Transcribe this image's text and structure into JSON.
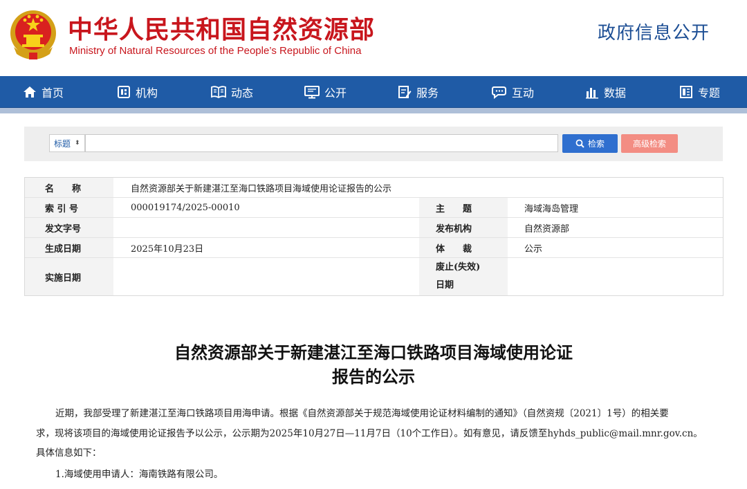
{
  "header": {
    "title_cn": "中华人民共和国自然资源部",
    "title_en": "Ministry of Natural Resources of the People’s Republic of China",
    "section": "政府信息公开",
    "emblem_icon": "national-emblem-icon"
  },
  "colors": {
    "brand_red": "#c8161d",
    "nav_blue": "#1f5ba6",
    "search_blue": "#2f6fcf",
    "advanced_pink": "#f38d83"
  },
  "nav": {
    "items": [
      {
        "label": "首页",
        "icon": "home-icon"
      },
      {
        "label": "机构",
        "icon": "org-icon"
      },
      {
        "label": "动态",
        "icon": "book-icon"
      },
      {
        "label": "公开",
        "icon": "monitor-icon"
      },
      {
        "label": "服务",
        "icon": "edit-doc-icon"
      },
      {
        "label": "互动",
        "icon": "chat-icon"
      },
      {
        "label": "数据",
        "icon": "bar-chart-icon"
      },
      {
        "label": "专题",
        "icon": "topic-icon"
      }
    ]
  },
  "search": {
    "select_value": "标题",
    "placeholder": "",
    "search_label": "检索",
    "advanced_label": "高级检索"
  },
  "meta": {
    "name_label": "名　　称",
    "name_value": "自然资源部关于新建湛江至海口铁路项目海域使用论证报告的公示",
    "index_label": "索 引 号",
    "index_value": "000019174/2025-00010",
    "subject_label": "主　　题",
    "subject_value": "海域海岛管理",
    "docno_label": "发文字号",
    "docno_value": "",
    "issuer_label": "发布机构",
    "issuer_value": "自然资源部",
    "created_label": "生成日期",
    "created_value": "2025年10月23日",
    "genre_label": "体　　裁",
    "genre_value": "公示",
    "effective_label": "实施日期",
    "effective_value": "",
    "repeal_label_1": "废止(失效)",
    "repeal_label_2": "日期",
    "repeal_value": ""
  },
  "article": {
    "title_line1": "自然资源部关于新建湛江至海口铁路项目海域使用论证",
    "title_line2": "报告的公示",
    "para1_line1": "近期，我部受理了新建湛江至海口铁路项目用海申请。根据《自然资源部关于规范海域使用论证材料编制的通知》（自然资规〔2021〕1号）的相关要",
    "para1_line2": "求，现将该项目的海域使用论证报告予以公示，公示期为2025年10月27日—11月7日（10个工作日）。如有意见，请反馈至hyhds_public@mail.mnr.gov.cn。",
    "para1_line3": "具体信息如下：",
    "item1": "1.海域使用申请人：海南铁路有限公司。"
  }
}
